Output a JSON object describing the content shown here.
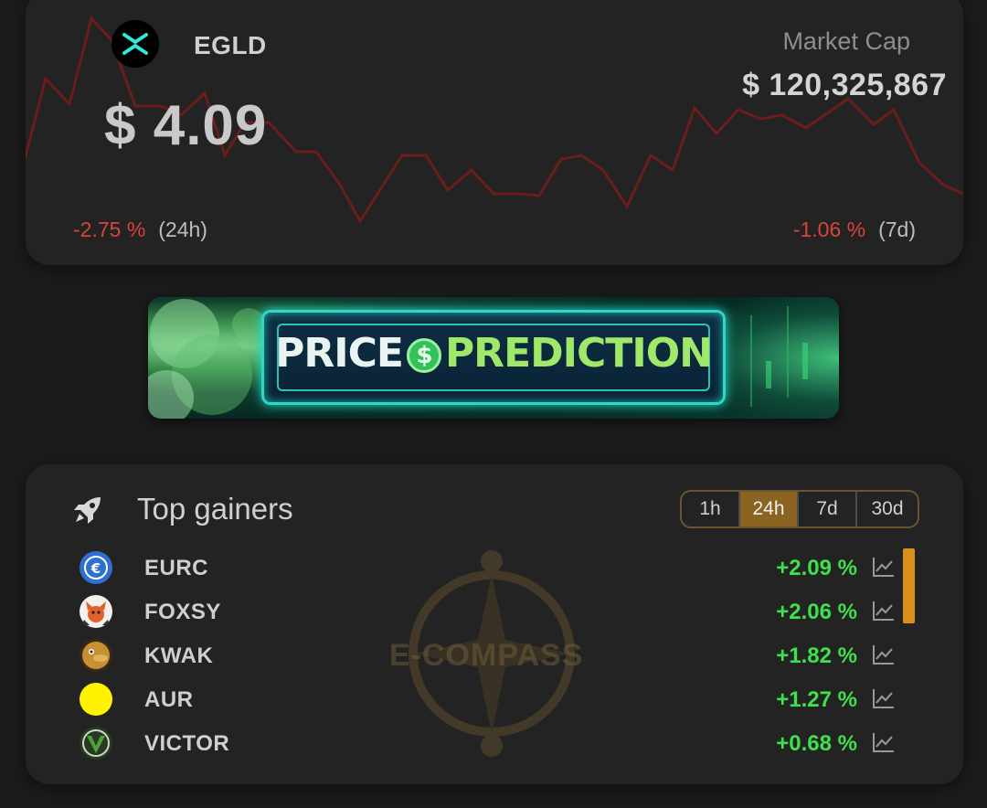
{
  "header": {
    "coin_symbol": "EGLD",
    "price": "$ 4.09",
    "market_cap_label": "Market Cap",
    "market_cap_value": "$ 120,325,867",
    "change_24h": "-2.75 %",
    "change_24h_period": "(24h)",
    "change_7d": "-1.06 %",
    "change_7d_period": "(7d)",
    "logo_icon": "multiversx-x-icon"
  },
  "banner": {
    "word1": "PRICE",
    "coin_glyph": "$",
    "word2": "PREDICTION"
  },
  "gainers": {
    "title": "Top gainers",
    "periods": [
      "1h",
      "24h",
      "7d",
      "30d"
    ],
    "selected_period": "24h",
    "watermark": "E-COMPASS",
    "rows": [
      {
        "symbol": "EURC",
        "change": "+2.09 %",
        "logo_color": "#2f6fd0"
      },
      {
        "symbol": "FOXSY",
        "change": "+2.06 %",
        "logo_color": "#e1612b"
      },
      {
        "symbol": "KWAK",
        "change": "+1.82 %",
        "logo_color": "#b07a2e"
      },
      {
        "symbol": "AUR",
        "change": "+1.27 %",
        "logo_color": "#fff200"
      },
      {
        "symbol": "VICTOR",
        "change": "+0.68 %",
        "logo_color": "#4ea23a"
      }
    ]
  },
  "colors": {
    "negative": "#d7443c",
    "positive": "#3ee14b",
    "accent": "#8a6420",
    "sparkline": "#6b1d1b"
  }
}
